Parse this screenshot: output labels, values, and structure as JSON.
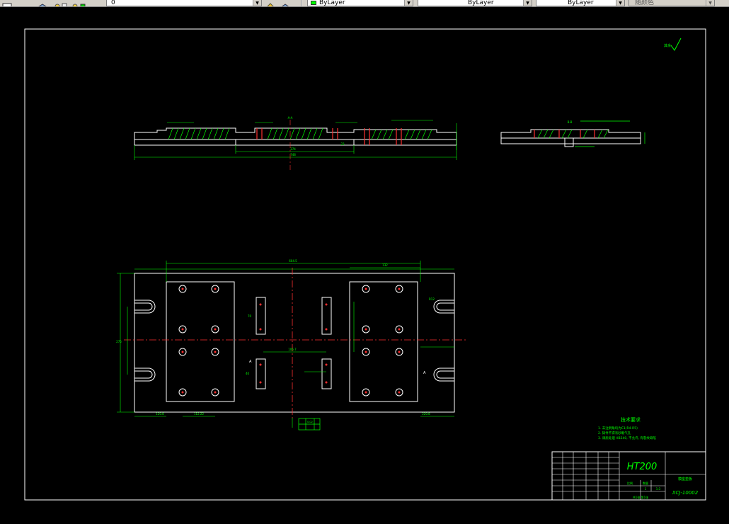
{
  "toolbar": {
    "layer_value": "0",
    "color_value": "ByLayer",
    "linetype_value": "ByLayer",
    "lineweight_value": "ByLayer",
    "plotstyle_value": "随颜色"
  },
  "drawing": {
    "material": "HT200",
    "drawing_number": "XCJ-10002",
    "part_name": "模座垫板",
    "roughness_note": "其余",
    "section_label": "A-A",
    "section_label_b": "B-B",
    "tech_requirements_title": "技术要求",
    "tech_requirements": [
      "1. 未注倒角均为C1(R4-R5)",
      "2. 铸件不得有砂眼气孔",
      "3. 调质处理 HB240, 不允许, 有裂纹缺陷"
    ],
    "dimensions": {
      "overall_width": "604.5",
      "overall_height": "275",
      "inner_width": "446",
      "left_spacing": "120.8",
      "left_pitch": "112.22",
      "right_spacing": "220.8",
      "center_offset": "106.7",
      "slot_height": "280.8",
      "plate_depth": "34",
      "flat_length": "374",
      "overall_length_section": "748",
      "section_depth": "23",
      "top_right": "132",
      "hole_label": "R12",
      "slot_dim_a": "40",
      "slot_dim_b": "70",
      "gdt": "0.02"
    },
    "title_block": {
      "scale_label": "比例",
      "scale_value": "1:3",
      "sheet_label": "共1张 第1张",
      "qty_label": "数量",
      "qty_value": "1"
    }
  }
}
